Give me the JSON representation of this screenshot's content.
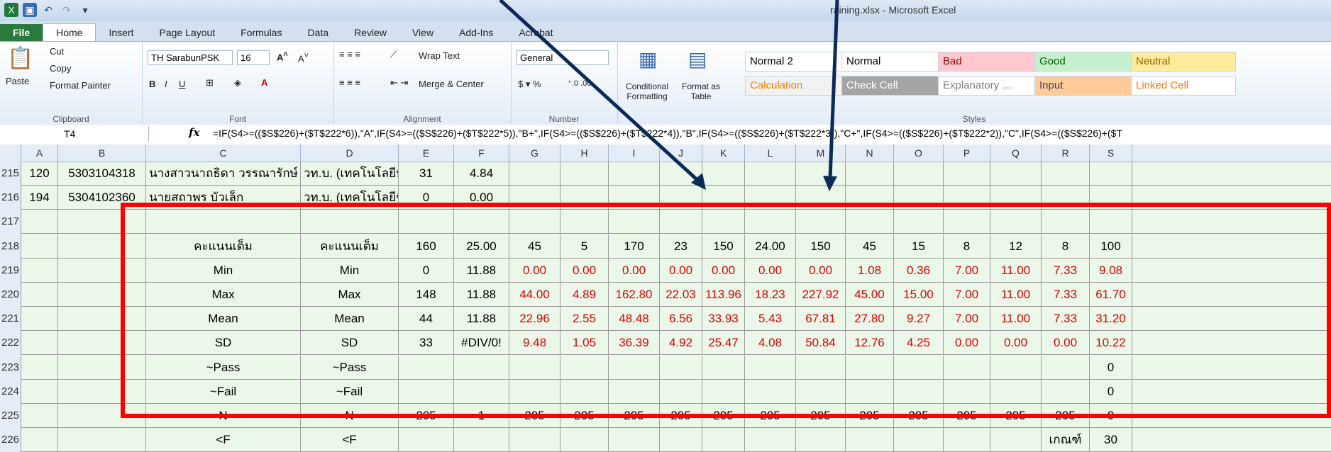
{
  "window": {
    "title": "raining.xlsx - Microsoft Excel"
  },
  "tabs": [
    "File",
    "Home",
    "Insert",
    "Page Layout",
    "Formulas",
    "Data",
    "Review",
    "View",
    "Add-Ins",
    "Acrobat"
  ],
  "ribbon": {
    "clipboard": {
      "paste": "Paste",
      "cut": "Cut",
      "copy": "Copy",
      "format_painter": "Format Painter",
      "label": "Clipboard"
    },
    "font": {
      "name": "TH SarabunPSK",
      "size": "16",
      "label": "Font"
    },
    "alignment": {
      "wrap": "Wrap Text",
      "merge": "Merge & Center",
      "label": "Alignment"
    },
    "number": {
      "format": "General",
      "label": "Number"
    },
    "styles_buttons": {
      "conditional": "Conditional Formatting",
      "format_table": "Format as Table",
      "label": "Styles"
    },
    "styles": [
      {
        "name": "Normal 2",
        "bg": "#ffffff",
        "fg": "#000000"
      },
      {
        "name": "Normal",
        "bg": "#ffffff",
        "fg": "#000000"
      },
      {
        "name": "Bad",
        "bg": "#ffc7ce",
        "fg": "#9c0006"
      },
      {
        "name": "Good",
        "bg": "#c6efce",
        "fg": "#006100"
      },
      {
        "name": "Neutral",
        "bg": "#ffeb9c",
        "fg": "#9c6500"
      },
      {
        "name": "Calculation",
        "bg": "#f2f2f2",
        "fg": "#fa7d00"
      },
      {
        "name": "Check Cell",
        "bg": "#a5a5a5",
        "fg": "#ffffff"
      },
      {
        "name": "Explanatory ...",
        "bg": "#ffffff",
        "fg": "#7f7f7f"
      },
      {
        "name": "Input",
        "bg": "#ffcc99",
        "fg": "#3f3f76"
      },
      {
        "name": "Linked Cell",
        "bg": "#ffffff",
        "fg": "#fa7d00"
      }
    ]
  },
  "formula_bar": {
    "cell_ref": "T4",
    "formula": "=IF(S4>=(($S$226)+($T$222*6)),\"A\",IF(S4>=(($S$226)+($T$222*5)),\"B+\",IF(S4>=(($S$226)+($T$222*4)),\"B\",IF(S4>=(($S$226)+($T$222*3)),\"C+\",IF(S4>=(($S$226)+($T$222*2)),\"C\",IF(S4>=(($S$226)+($T"
  },
  "columns": [
    "A",
    "B",
    "C",
    "D",
    "E",
    "F",
    "G",
    "H",
    "I",
    "J",
    "K",
    "L",
    "M",
    "N",
    "O",
    "P",
    "Q",
    "R",
    "S"
  ],
  "rows": [
    {
      "num": "215",
      "cells": [
        "120",
        "5303104318",
        "นางสาวนาถธิดา วรรณารักษ์",
        "วท.บ. (เทคโนโลยีหลังเ",
        "31",
        "4.84",
        "",
        "",
        "",
        "",
        "",
        "",
        "",
        "",
        "",
        "",
        "",
        "",
        ""
      ]
    },
    {
      "num": "216",
      "cells": [
        "194",
        "5304102360",
        "นายสถาพร บัวเล็ก",
        "วท.บ. (เทคโนโลยีชีวภ",
        "0",
        "0.00",
        "",
        "",
        "",
        "",
        "",
        "",
        "",
        "",
        "",
        "",
        "",
        "",
        ""
      ]
    },
    {
      "num": "217",
      "cells": [
        "",
        "",
        "",
        "",
        "",
        "",
        "",
        "",
        "",
        "",
        "",
        "",
        "",
        "",
        "",
        "",
        "",
        "",
        ""
      ]
    },
    {
      "num": "218",
      "cells": [
        "",
        "",
        "คะแนนเต็ม",
        "คะแนนเต็ม",
        "160",
        "25.00",
        "45",
        "5",
        "170",
        "23",
        "150",
        "24.00",
        "150",
        "45",
        "15",
        "8",
        "12",
        "8",
        "100"
      ]
    },
    {
      "num": "219",
      "cells": [
        "",
        "",
        "Min",
        "Min",
        "0",
        "11.88",
        "0.00",
        "0.00",
        "0.00",
        "0.00",
        "0.00",
        "0.00",
        "0.00",
        "1.08",
        "0.36",
        "7.00",
        "11.00",
        "7.33",
        "9.08"
      ]
    },
    {
      "num": "220",
      "cells": [
        "",
        "",
        "Max",
        "Max",
        "148",
        "11.88",
        "44.00",
        "4.89",
        "162.80",
        "22.03",
        "113.96",
        "18.23",
        "227.92",
        "45.00",
        "15.00",
        "7.00",
        "11.00",
        "7.33",
        "61.70"
      ]
    },
    {
      "num": "221",
      "cells": [
        "",
        "",
        "Mean",
        "Mean",
        "44",
        "11.88",
        "22.96",
        "2.55",
        "48.48",
        "6.56",
        "33.93",
        "5.43",
        "67.81",
        "27.80",
        "9.27",
        "7.00",
        "11.00",
        "7.33",
        "31.20"
      ]
    },
    {
      "num": "222",
      "cells": [
        "",
        "",
        "SD",
        "SD",
        "33",
        "#DIV/0!",
        "9.48",
        "1.05",
        "36.39",
        "4.92",
        "25.47",
        "4.08",
        "50.84",
        "12.76",
        "4.25",
        "0.00",
        "0.00",
        "0.00",
        "10.22"
      ]
    },
    {
      "num": "223",
      "cells": [
        "",
        "",
        "~Pass",
        "~Pass",
        "",
        "",
        "",
        "",
        "",
        "",
        "",
        "",
        "",
        "",
        "",
        "",
        "",
        "",
        "0"
      ]
    },
    {
      "num": "224",
      "cells": [
        "",
        "",
        "~Fail",
        "~Fail",
        "",
        "",
        "",
        "",
        "",
        "",
        "",
        "",
        "",
        "",
        "",
        "",
        "",
        "",
        "0"
      ]
    },
    {
      "num": "225",
      "cells": [
        "",
        "",
        "N",
        "N",
        "205",
        "1",
        "205",
        "205",
        "205",
        "205",
        "205",
        "205",
        "205",
        "205",
        "205",
        "205",
        "205",
        "205",
        "0"
      ]
    },
    {
      "num": "226",
      "cells": [
        "",
        "",
        "<F",
        "<F",
        "",
        "",
        "",
        "",
        "",
        "",
        "",
        "",
        "",
        "",
        "",
        "",
        "",
        "เกณฑ์",
        "30"
      ]
    }
  ]
}
